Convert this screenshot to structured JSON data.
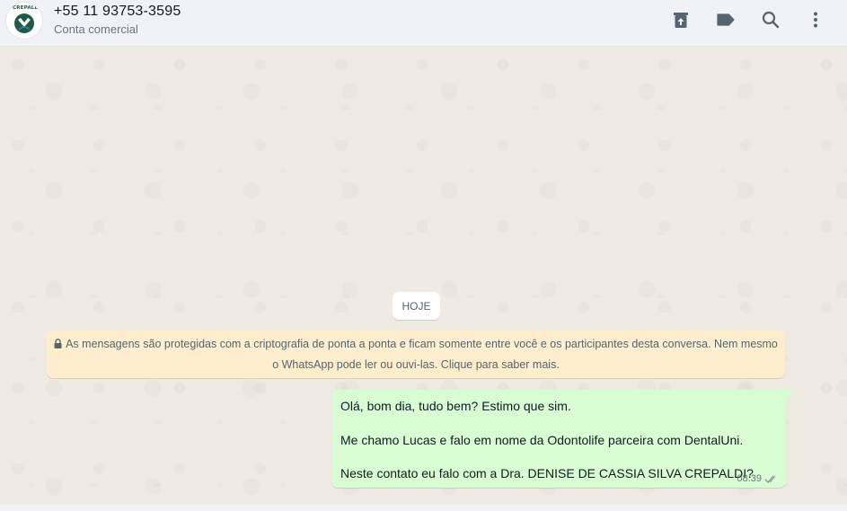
{
  "header": {
    "contact_name": "+55 11 93753-3595",
    "contact_subtitle": "Conta comercial",
    "avatar_text": "CREPALDI",
    "icons": [
      "archive-icon",
      "label-icon",
      "search-icon",
      "menu-icon"
    ]
  },
  "chat": {
    "date_chip": "HOJE",
    "encryption_line1": "As mensagens são protegidas com a criptografia de ponta a ponta e ficam somente entre você e os participantes desta conversa. Nem mesmo",
    "encryption_line2": "o WhatsApp pode ler ou ouvi-las. Clique para saber mais.",
    "message": {
      "lines": [
        "Olá, bom dia, tudo bem? Estimo que sim.",
        "Me chamo Lucas e falo em nome da Odontolife parceira com DentalUni.",
        "Neste contato eu falo com a Dra. DENISE DE CASSIA SILVA CREPALDI?"
      ],
      "time": "08:39",
      "status_icon": "double-check-icon"
    }
  },
  "colors": {
    "header_bg": "#f0f2f5",
    "chat_bg": "#efeae2",
    "outgoing_bubble": "#d9fdd3",
    "encryption_bg": "#ffeecd"
  }
}
